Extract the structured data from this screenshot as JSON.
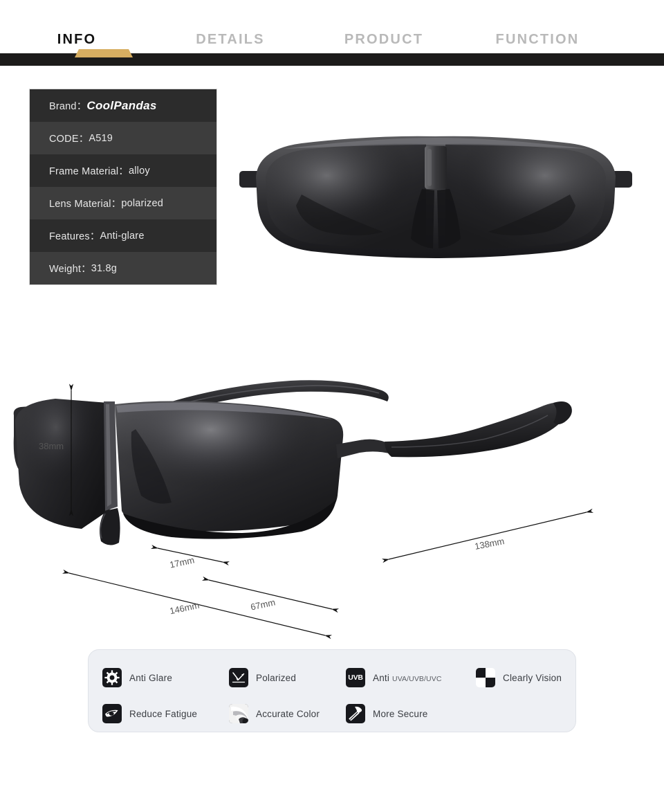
{
  "tabs": [
    {
      "label": "INFO",
      "active": true
    },
    {
      "label": "DETAILS",
      "active": false
    },
    {
      "label": "PRODUCT",
      "active": false
    },
    {
      "label": "FUNCTION",
      "active": false
    }
  ],
  "colors": {
    "accent_gold": "#d7ae61",
    "dark_band": "#1c1b1a",
    "row_dark": "#2c2c2c",
    "row_light": "#3d3d3d",
    "panel_bg": "#eef0f4",
    "icon_bg": "#17181c",
    "tab_active": "#111111",
    "tab_inactive": "#b9b9b9"
  },
  "info_table": {
    "rows": [
      {
        "label": "Brand：",
        "value": "CoolPandas",
        "brand": true
      },
      {
        "label": "CODE：",
        "value": "A519"
      },
      {
        "label": "Frame Material：",
        "value": "alloy"
      },
      {
        "label": "Lens Material：",
        "value": "polarized"
      },
      {
        "label": "Features：",
        "value": "Anti-glare"
      },
      {
        "label": "Weight：",
        "value": "31.8g"
      }
    ]
  },
  "dimensions": {
    "height": "38mm",
    "bridge": "17mm",
    "lens_width": "67mm",
    "total_width": "146mm",
    "temple": "138mm"
  },
  "features": [
    {
      "label": "Anti Glare",
      "sub": "",
      "icon": "sun-icon"
    },
    {
      "label": "Polarized",
      "sub": "",
      "icon": "polarized-ray-icon"
    },
    {
      "label": "Anti",
      "sub": "UVA/UVB/UVC",
      "icon": "uvb-icon"
    },
    {
      "label": "Clearly Vision",
      "sub": "",
      "icon": "checkerboard-icon"
    },
    {
      "label": "Reduce Fatigue",
      "sub": "",
      "icon": "eye-icon"
    },
    {
      "label": "Accurate Color",
      "sub": "",
      "icon": "color-swirl-icon"
    },
    {
      "label": "More Secure",
      "sub": "",
      "icon": "hammer-icon"
    }
  ],
  "product": {
    "front_view_alt": "black wrap-around polarized sunglasses front view",
    "angled_view_alt": "black wrap-around polarized sunglasses three-quarter view"
  }
}
